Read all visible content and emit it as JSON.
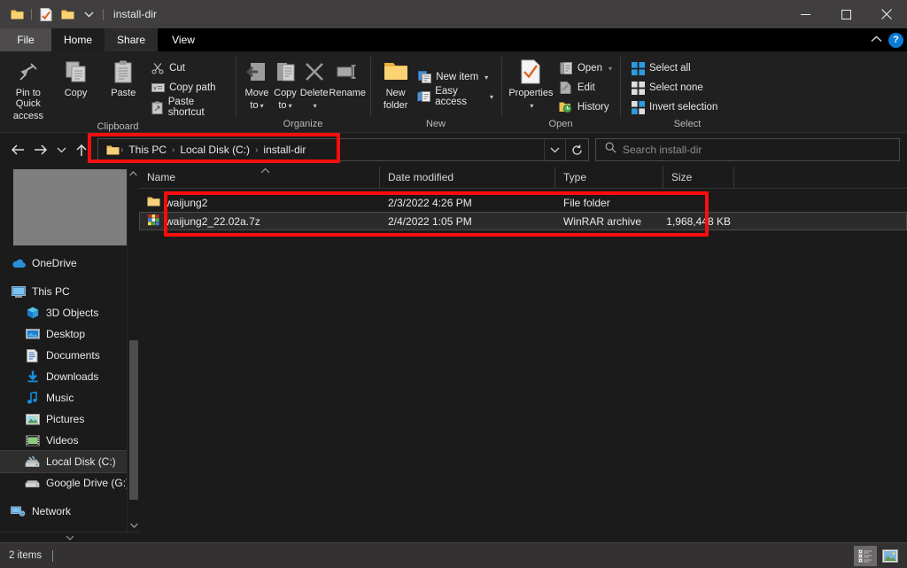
{
  "window": {
    "title": "install-dir",
    "quick_access_icons": [
      "folder-icon",
      "properties-icon",
      "new-folder-icon",
      "customize-chevron-icon"
    ],
    "minimize_label": "—",
    "maximize_label": "☐",
    "close_label": "✕"
  },
  "tabs": [
    {
      "label": "File",
      "state": "file-menu"
    },
    {
      "label": "Home",
      "state": "active"
    },
    {
      "label": "Share",
      "state": "inactive"
    },
    {
      "label": "View",
      "state": "inactive"
    }
  ],
  "tab_right": {
    "collapse_ribbon": "⌃",
    "help_label": "?"
  },
  "ribbon": {
    "groups": [
      {
        "name": "Clipboard",
        "title": "Clipboard",
        "big_buttons": [
          {
            "label": "Pin to Quick\naccess",
            "line1": "Pin to Quick",
            "line2": "access",
            "icon": "pin-icon"
          },
          {
            "label": "Copy",
            "line1": "Copy",
            "line2": "",
            "icon": "copy-icon"
          },
          {
            "label": "Paste",
            "line1": "Paste",
            "line2": "",
            "icon": "paste-icon"
          }
        ],
        "small_buttons": [
          {
            "label": "Cut",
            "icon": "scissors-icon",
            "dropdown": false
          },
          {
            "label": "Copy path",
            "icon": "copy-path-icon",
            "dropdown": false
          },
          {
            "label": "Paste shortcut",
            "icon": "paste-shortcut-icon",
            "dropdown": false
          }
        ]
      },
      {
        "name": "Organize",
        "title": "Organize",
        "big_buttons": [
          {
            "line1": "Move",
            "line2": "to",
            "icon": "move-to-icon",
            "dropdown": true
          },
          {
            "line1": "Copy",
            "line2": "to",
            "icon": "copy-to-icon",
            "dropdown": true
          },
          {
            "line1": "Delete",
            "line2": "",
            "icon": "delete-icon",
            "dropdown": true
          },
          {
            "line1": "Rename",
            "line2": "",
            "icon": "rename-icon",
            "dropdown": false
          }
        ],
        "small_buttons": []
      },
      {
        "name": "New",
        "title": "New",
        "big_buttons": [
          {
            "line1": "New",
            "line2": "folder",
            "icon": "new-folder-icon",
            "dropdown": false
          }
        ],
        "small_buttons": [
          {
            "label": "New item",
            "icon": "new-item-icon",
            "dropdown": true
          },
          {
            "label": "Easy access",
            "icon": "easy-access-icon",
            "dropdown": true
          }
        ]
      },
      {
        "name": "Open",
        "title": "Open",
        "big_buttons": [
          {
            "line1": "Properties",
            "line2": "",
            "icon": "properties-icon",
            "dropdown": true
          }
        ],
        "small_buttons": [
          {
            "label": "Open",
            "icon": "open-icon",
            "dropdown": true
          },
          {
            "label": "Edit",
            "icon": "edit-icon",
            "dropdown": false
          },
          {
            "label": "History",
            "icon": "history-icon",
            "dropdown": false
          }
        ]
      },
      {
        "name": "Select",
        "title": "Select",
        "big_buttons": [],
        "small_buttons": [
          {
            "label": "Select all",
            "icon": "select-all-icon",
            "dropdown": false
          },
          {
            "label": "Select none",
            "icon": "select-none-icon",
            "dropdown": false
          },
          {
            "label": "Invert selection",
            "icon": "invert-selection-icon",
            "dropdown": false
          }
        ]
      }
    ]
  },
  "navigation": {
    "back": "←",
    "forward": "→",
    "recent": "⌄",
    "up": "↑",
    "breadcrumb_icon": "folder-icon",
    "breadcrumbs": [
      "This PC",
      "Local Disk (C:)",
      "install-dir"
    ],
    "separator": "›",
    "dropdown": "⌄",
    "refresh": "⟳"
  },
  "search": {
    "icon": "search-icon",
    "placeholder": "Search install-dir"
  },
  "sidebar": {
    "items": [
      {
        "label": "OneDrive",
        "icon": "onedrive-cloud-icon",
        "indent": false,
        "selected": false
      },
      {
        "label": "This PC",
        "icon": "this-pc-icon",
        "indent": false,
        "selected": false
      },
      {
        "label": "3D Objects",
        "icon": "3d-objects-icon",
        "indent": true,
        "selected": false
      },
      {
        "label": "Desktop",
        "icon": "desktop-icon",
        "indent": true,
        "selected": false
      },
      {
        "label": "Documents",
        "icon": "documents-icon",
        "indent": true,
        "selected": false
      },
      {
        "label": "Downloads",
        "icon": "downloads-icon",
        "indent": true,
        "selected": false
      },
      {
        "label": "Music",
        "icon": "music-icon",
        "indent": true,
        "selected": false
      },
      {
        "label": "Pictures",
        "icon": "pictures-icon",
        "indent": true,
        "selected": false
      },
      {
        "label": "Videos",
        "icon": "videos-icon",
        "indent": true,
        "selected": false
      },
      {
        "label": "Local Disk (C:)",
        "icon": "local-disk-icon",
        "indent": true,
        "selected": true
      },
      {
        "label": "Google Drive (G:)",
        "icon": "drive-icon",
        "indent": true,
        "selected": false
      },
      {
        "label": "Network",
        "icon": "network-icon",
        "indent": false,
        "selected": false
      }
    ]
  },
  "file_list": {
    "columns": [
      {
        "key": "name",
        "label": "Name",
        "sorted": "asc"
      },
      {
        "key": "date",
        "label": "Date modified",
        "sorted": null
      },
      {
        "key": "type",
        "label": "Type",
        "sorted": null
      },
      {
        "key": "size",
        "label": "Size",
        "sorted": null
      }
    ],
    "rows": [
      {
        "name": "waijung2",
        "date": "2/3/2022 4:26 PM",
        "type": "File folder",
        "size": "",
        "icon": "folder-icon",
        "selected": false
      },
      {
        "name": "waijung2_22.02a.7z",
        "date": "2/4/2022 1:05 PM",
        "type": "WinRAR archive",
        "size": "1,968,448 KB",
        "icon": "winrar-archive-icon",
        "selected": true
      }
    ]
  },
  "status": {
    "item_count": "2 items",
    "view_details_icon": "details-view-icon",
    "view_large_icons_icon": "large-icons-view-icon"
  },
  "annotations": {
    "highlight_color": "#fb0d0d",
    "boxes": [
      "address-bar-highlight",
      "file-list-highlight"
    ]
  }
}
